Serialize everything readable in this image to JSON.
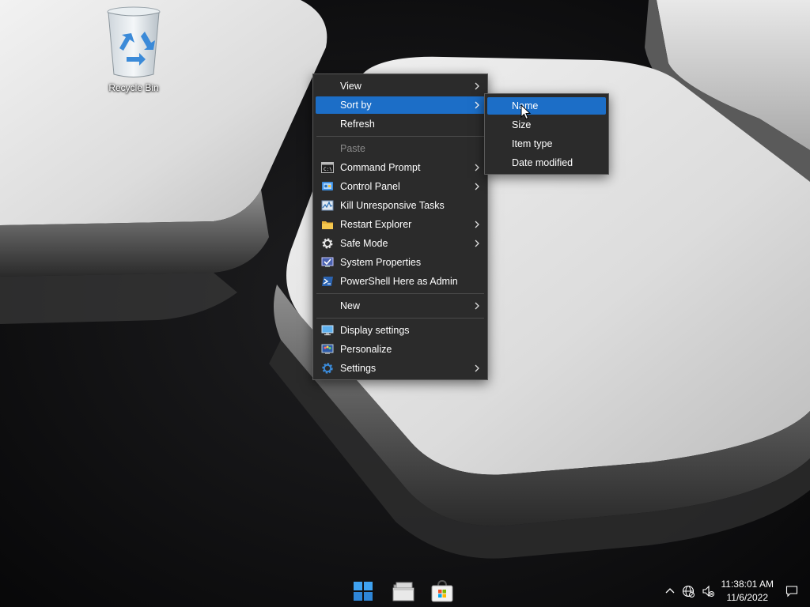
{
  "desktop": {
    "icons": [
      {
        "label": "Recycle Bin",
        "icon": "recycle-bin-icon"
      }
    ]
  },
  "context_menu": {
    "items": [
      {
        "label": "View",
        "icon": null,
        "submenu": true,
        "disabled": false
      },
      {
        "label": "Sort by",
        "icon": null,
        "submenu": true,
        "disabled": false,
        "highlighted": true
      },
      {
        "label": "Refresh",
        "icon": null,
        "submenu": false,
        "disabled": false
      },
      {
        "label": "Paste",
        "icon": null,
        "submenu": false,
        "disabled": true
      },
      {
        "label": "Command Prompt",
        "icon": "command-prompt-icon",
        "submenu": true,
        "disabled": false
      },
      {
        "label": "Control Panel",
        "icon": "control-panel-icon",
        "submenu": true,
        "disabled": false
      },
      {
        "label": "Kill Unresponsive Tasks",
        "icon": "task-manager-icon",
        "submenu": false,
        "disabled": false
      },
      {
        "label": "Restart Explorer",
        "icon": "folder-icon",
        "submenu": true,
        "disabled": false
      },
      {
        "label": "Safe Mode",
        "icon": "gear-icon",
        "submenu": true,
        "disabled": false
      },
      {
        "label": "System Properties",
        "icon": "system-properties-icon",
        "submenu": false,
        "disabled": false
      },
      {
        "label": "PowerShell Here as Admin",
        "icon": "powershell-icon",
        "submenu": false,
        "disabled": false
      },
      {
        "label": "New",
        "icon": null,
        "submenu": true,
        "disabled": false
      },
      {
        "label": "Display settings",
        "icon": "display-settings-icon",
        "submenu": false,
        "disabled": false
      },
      {
        "label": "Personalize",
        "icon": "personalize-icon",
        "submenu": false,
        "disabled": false
      },
      {
        "label": "Settings",
        "icon": "settings-gear-icon",
        "submenu": true,
        "disabled": false
      }
    ]
  },
  "sort_submenu": {
    "items": [
      {
        "label": "Name",
        "highlighted": true
      },
      {
        "label": "Size"
      },
      {
        "label": "Item type"
      },
      {
        "label": "Date modified"
      }
    ]
  },
  "taskbar": {
    "apps": [
      {
        "name": "Start",
        "icon": "windows-start-icon"
      },
      {
        "name": "File Explorer",
        "icon": "file-explorer-icon"
      },
      {
        "name": "Microsoft Store",
        "icon": "store-icon"
      }
    ],
    "tray": {
      "icons": [
        "chevron-up-icon",
        "network-icon",
        "volume-muted-icon",
        "notification-icon"
      ],
      "time": "11:38:01 AM",
      "date": "11/6/2022"
    }
  },
  "colors": {
    "menu_bg": "#2b2b2b",
    "highlight": "#1c6ec7",
    "disabled_text": "#8a8a8a"
  }
}
